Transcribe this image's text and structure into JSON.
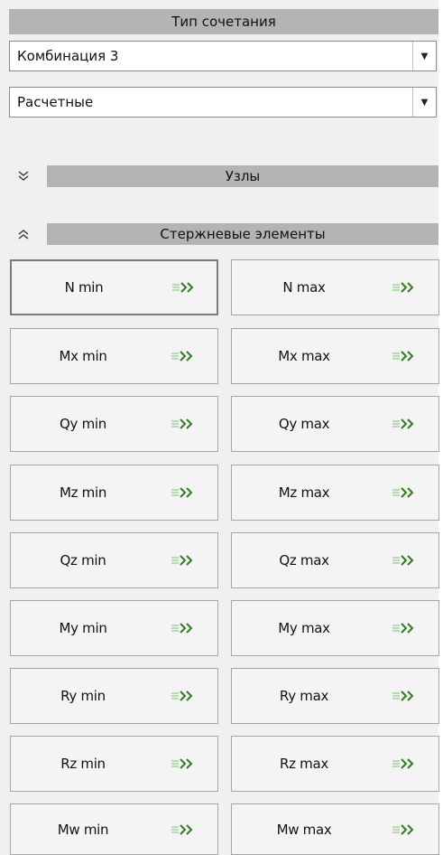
{
  "header": {
    "title": "Тип сочетания"
  },
  "combos": {
    "combination_value": "Комбинация 3",
    "values_type_value": "Расчетные"
  },
  "sections": {
    "nodes_label": "Узлы",
    "bar_elements_label": "Стержневые элементы"
  },
  "icons": {
    "nodes_toggle": "chevrons-down-icon",
    "bars_toggle": "chevrons-up-icon",
    "combo_dropdown": "caret-down-icon",
    "button_arrow": "double-arrow-right-icon"
  },
  "colors": {
    "section_header_bg": "#b4b4b4",
    "arrow_green": "#2e7d1e",
    "arrow_light_green": "#8fc78a"
  },
  "buttons": [
    {
      "left": "N min",
      "right": "N max"
    },
    {
      "left": "Mx min",
      "right": "Mx max"
    },
    {
      "left": "Qy min",
      "right": "Qy max"
    },
    {
      "left": "Mz min",
      "right": "Mz max"
    },
    {
      "left": "Qz min",
      "right": "Qz max"
    },
    {
      "left": "My min",
      "right": "My max"
    },
    {
      "left": "Ry min",
      "right": "Ry max"
    },
    {
      "left": "Rz min",
      "right": "Rz max"
    },
    {
      "left": "Mw min",
      "right": "Mw max"
    }
  ]
}
